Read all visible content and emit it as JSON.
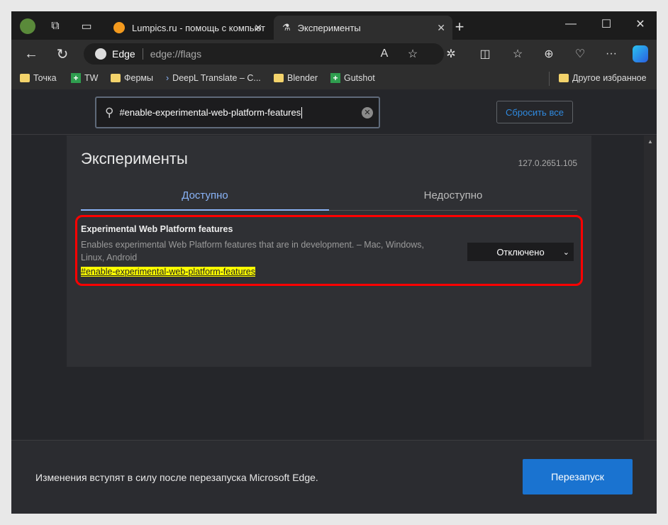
{
  "tabs": [
    {
      "label": "Lumpics.ru - помощь с компьют",
      "icon": "orange-icon"
    },
    {
      "label": "Эксперименты",
      "icon": "flask-icon",
      "active": true
    }
  ],
  "address": {
    "site_label": "Edge",
    "url": "edge://flags"
  },
  "bookmarks": [
    {
      "label": "Точка",
      "icon": "folder"
    },
    {
      "label": "TW",
      "icon": "sheets"
    },
    {
      "label": "Фермы",
      "icon": "folder"
    },
    {
      "label": "DeepL Translate – C...",
      "icon": "deepl"
    },
    {
      "label": "Blender",
      "icon": "folder"
    },
    {
      "label": "Gutshot",
      "icon": "sheets"
    }
  ],
  "other_favorites": "Другое избранное",
  "search": {
    "value": "#enable-experimental-web-platform-features"
  },
  "reset_label": "Сбросить все",
  "page": {
    "title": "Эксперименты",
    "version": "127.0.2651.105"
  },
  "page_tabs": [
    {
      "label": "Доступно",
      "active": true
    },
    {
      "label": "Недоступно"
    }
  ],
  "flag": {
    "title": "Experimental Web Platform features",
    "description": "Enables experimental Web Platform features that are in development. – Mac, Windows, Linux, Android",
    "link": "#enable-experimental-web-platform-features",
    "select_value": "Отключено"
  },
  "footer": {
    "message": "Изменения вступят в силу после перезапуска Microsoft Edge.",
    "restart_label": "Перезапуск"
  },
  "colors": {
    "accent": "#1a73d0",
    "highlight": "#ffff00",
    "annotation": "#ff0000",
    "active_tab": "#8ab4f8"
  }
}
